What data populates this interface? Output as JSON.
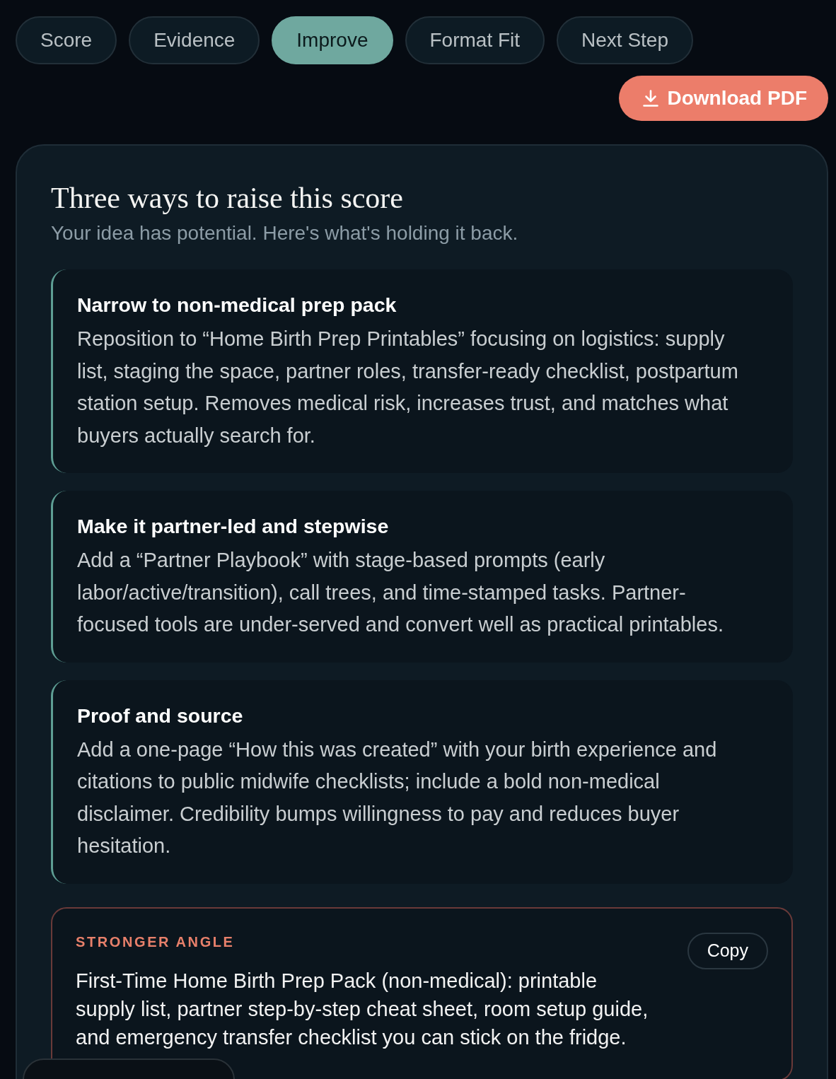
{
  "tabs": [
    {
      "label": "Score",
      "selected": false
    },
    {
      "label": "Evidence",
      "selected": false
    },
    {
      "label": "Improve",
      "selected": true
    },
    {
      "label": "Format Fit",
      "selected": false
    },
    {
      "label": "Next Step",
      "selected": false
    }
  ],
  "download_button": {
    "label": "Download PDF"
  },
  "panel": {
    "title": "Three ways to raise this score",
    "subtitle": "Your idea has potential. Here's what's holding it back.",
    "suggestions": [
      {
        "title": "Narrow to non-medical prep pack",
        "body": "Reposition to “Home Birth Prep Printables” focusing on logistics: supply list, staging the space, partner roles, transfer-ready checklist, postpartum station setup. Removes medical risk, increases trust, and matches what buyers actually search for."
      },
      {
        "title": "Make it partner-led and stepwise",
        "body": "Add a “Partner Playbook” with stage-based prompts (early labor/active/transition), call trees, and time-stamped tasks. Partner-focused tools are under-served and convert well as practical printables."
      },
      {
        "title": "Proof and source",
        "body": "Add a one-page “How this was created” with your birth experience and citations to public midwife checklists; include a bold non-medical disclaimer. Credibility bumps willingness to pay and reduces buyer hesitation."
      }
    ],
    "stronger_angle": {
      "label": "STRONGER ANGLE",
      "copy_button": "Copy",
      "text": "First-Time Home Birth Prep Pack (non-medical): printable supply list, partner step-by-step cheat sheet, room setup guide, and emergency transfer checklist you can stick on the fridge."
    }
  }
}
